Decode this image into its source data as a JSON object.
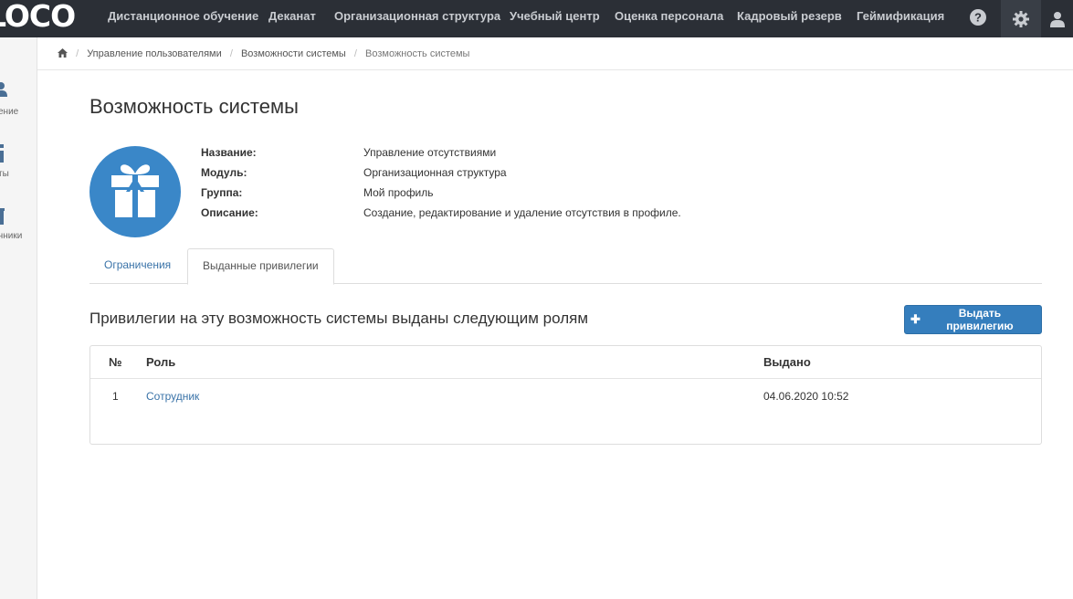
{
  "navbar": {
    "logo_text": "LOCO",
    "items": [
      {
        "label": "Дистанционное обучение"
      },
      {
        "label": "Деканат"
      },
      {
        "label": "Организационная структура"
      },
      {
        "label": "Учебный центр"
      },
      {
        "label": "Оценка персонала"
      },
      {
        "label": "Кадровый резерв"
      },
      {
        "label": "Геймификация"
      }
    ],
    "icons": [
      "help-icon",
      "gear-icon",
      "user-icon"
    ]
  },
  "sidebar": {
    "items": [
      {
        "icon": "users-icon",
        "label": "ение"
      },
      {
        "icon": "info-icon",
        "label": "ты"
      },
      {
        "icon": "book-icon",
        "label": "чники"
      }
    ]
  },
  "breadcrumb": {
    "items": [
      {
        "label": "Управление пользователями"
      },
      {
        "label": "Возможности системы"
      },
      {
        "label": "Возможность системы"
      }
    ]
  },
  "page": {
    "title": "Возможность системы",
    "icon": "gift-icon",
    "properties": [
      {
        "key": "Название:",
        "value": "Управление отсутствиями"
      },
      {
        "key": "Модуль:",
        "value": "Организационная структура"
      },
      {
        "key": "Группа:",
        "value": "Мой профиль"
      },
      {
        "key": "Описание:",
        "value": "Создание, редактирование и удаление отсутствия в профиле."
      }
    ],
    "tabs": [
      {
        "label": "Ограничения",
        "active": false
      },
      {
        "label": "Выданные привилегии",
        "active": true
      }
    ]
  },
  "privileges": {
    "title": "Привилегии на эту возможность системы выданы следующим ролям",
    "grant_button": "Выдать привилегию",
    "columns": [
      "№",
      "Роль",
      "Выдано"
    ],
    "rows": [
      {
        "num": "1",
        "role": "Сотрудник",
        "issued": "04.06.2020 10:52"
      }
    ]
  },
  "colors": {
    "navbar_bg": "#2b2f36",
    "accent": "#357ebd",
    "link": "#3a73a8",
    "icon_circle": "#3a87c8"
  }
}
